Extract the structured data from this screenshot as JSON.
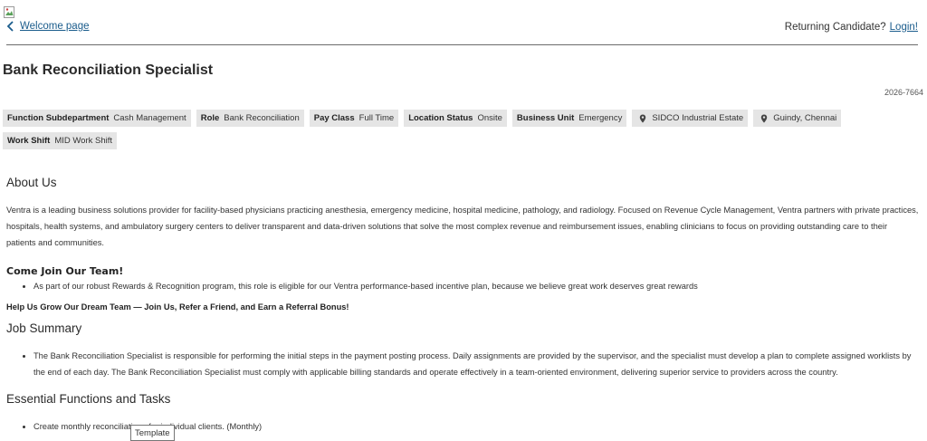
{
  "nav": {
    "back_label": "Welcome page",
    "returning_text": "Returning Candidate?",
    "login_label": "Login!"
  },
  "job": {
    "title": "Bank Reconciliation Specialist",
    "req_id": "2026-7664"
  },
  "tags": [
    {
      "key": "Function Subdepartment",
      "value": "Cash Management"
    },
    {
      "key": "Role",
      "value": "Bank Reconciliation"
    },
    {
      "key": "Pay Class",
      "value": "Full Time"
    },
    {
      "key": "Location Status",
      "value": "Onsite"
    },
    {
      "key": "Business Unit",
      "value": "Emergency"
    },
    {
      "icon": "location-pin-icon",
      "value": "SIDCO Industrial Estate"
    },
    {
      "icon": "location-pin-icon",
      "value": "Guindy, Chennai"
    },
    {
      "key": "Work Shift",
      "value": "MID Work Shift"
    }
  ],
  "about": {
    "heading": "About Us",
    "text": "Ventra is a leading business solutions provider for facility-based physicians practicing anesthesia, emergency medicine, hospital medicine, pathology, and radiology. Focused on Revenue Cycle Management, Ventra partners with private practices, hospitals, health systems, and ambulatory surgery centers to deliver transparent and data-driven solutions that solve the most complex revenue and reimbursement issues, enabling clinicians to focus on providing outstanding care to their patients and communities."
  },
  "join": {
    "heading": "Come Join Our Team!",
    "bullets": [
      "As part of our robust Rewards & Recognition program, this role is eligible for our Ventra performance-based incentive plan, because we believe great work deserves great rewards"
    ],
    "referral": "Help Us Grow Our Dream Team — Join Us, Refer a Friend, and Earn a Referral Bonus!"
  },
  "summary": {
    "heading": "Job Summary",
    "bullets": [
      "The Bank Reconciliation Specialist is responsible for performing the initial steps in the payment posting process. Daily assignments are provided by the supervisor, and the specialist must develop a plan to complete assigned worklists by the end of each day. The Bank Reconciliation Specialist must comply with applicable billing standards and operate effectively in a team-oriented environment, delivering superior service to providers across the country."
    ]
  },
  "functions": {
    "heading": "Essential Functions and Tasks",
    "bullets": [
      "Create monthly reconciliations for individual clients. (Monthly)"
    ]
  },
  "tooltip": "Template"
}
